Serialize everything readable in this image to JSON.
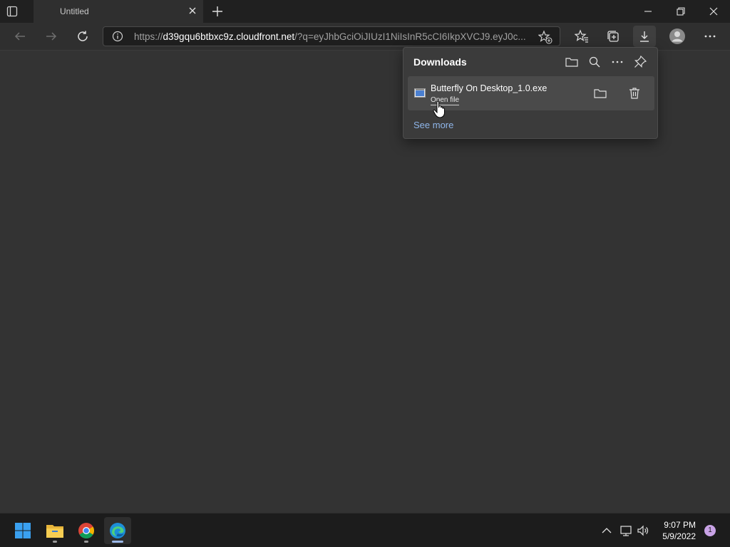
{
  "tab": {
    "title": "Untitled"
  },
  "address": {
    "prefix": "https://",
    "host": "d39gqu6btbxc9z.cloudfront.net",
    "rest": "/?q=eyJhbGciOiJIUzI1NiIsInR5cCI6IkpXVCJ9.eyJ0c..."
  },
  "downloads": {
    "title": "Downloads",
    "item": {
      "file_name": "Butterfly On Desktop_1.0.exe",
      "action_label": "Open file"
    },
    "see_more": "See more"
  },
  "taskbar": {
    "time": "9:07 PM",
    "date": "5/9/2022",
    "notification_count": "1"
  },
  "colors": {
    "background": "#333333",
    "chrome": "#202020",
    "flyout": "#3b3b3b",
    "link": "#8fb6ea",
    "edge_blue": "#1d8fd8",
    "edge_green": "#4fd07a"
  },
  "icons": {
    "tab_actions": "tab-actions-icon",
    "back": "back-arrow-icon",
    "forward": "forward-arrow-icon",
    "refresh": "refresh-icon",
    "info": "info-icon",
    "add_favorite": "add-favorite-icon",
    "favorites": "favorites-icon",
    "collections": "collections-icon",
    "download": "download-icon",
    "profile": "profile-avatar-icon",
    "more": "more-icon"
  }
}
